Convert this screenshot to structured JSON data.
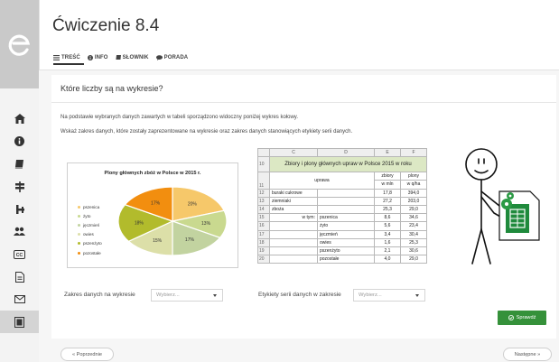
{
  "header": {
    "title": "Ćwiczenie 8.4",
    "tabs": [
      {
        "icon": "list-icon",
        "label": "TREŚĆ"
      },
      {
        "icon": "info-icon",
        "label": "INFO"
      },
      {
        "icon": "book-icon",
        "label": "SŁOWNIK"
      },
      {
        "icon": "chat-icon",
        "label": "PORADA"
      }
    ]
  },
  "sidebar": {
    "items": [
      "home-icon",
      "info-icon",
      "book-icon",
      "signpost-icon",
      "tool-icon",
      "people-icon",
      "cc-icon",
      "document-icon",
      "mail-icon",
      "notepad-icon"
    ]
  },
  "exercise": {
    "question": "Które liczby są na wykresie?",
    "p1": "Na podstawie wybranych danych zawartych w tabeli sporządzono widoczny poniżej wykres kołowy.",
    "p2": "Wskaż zakres danych, które zostały zaprezentowane na wykresie oraz zakres danych stanowiących etykiety serii danych."
  },
  "chart_data": {
    "type": "pie",
    "title": "Plony głównych zbóż w Polsce w 2015 r.",
    "categories": [
      "pszenica",
      "żyto",
      "jęczmień",
      "owies",
      "pszenżyto",
      "pozostałe"
    ],
    "values": [
      20,
      13,
      17,
      15,
      18,
      17
    ],
    "labels": [
      "20%",
      "13%",
      "17%",
      "15%",
      "18%",
      "17%"
    ],
    "colors": [
      "#f6c86a",
      "#c9d98f",
      "#c2d3a0",
      "#dcdfa8",
      "#b2bb2c",
      "#f28e0f"
    ],
    "legend": "left"
  },
  "sheet": {
    "cols": [
      "C",
      "D",
      "E",
      "F"
    ],
    "title": "Zbiory i plony głównych upraw w Polsce 2015 w roku",
    "head": {
      "uprawa": "uprawa",
      "zbiory": "zbiory",
      "zbiory_unit": "w mln",
      "plony": "plony",
      "plony_unit": "w q/ha"
    },
    "rows": [
      {
        "n": "12",
        "c": "buraki cukrowe",
        "d": "",
        "e": "17,8",
        "f": "394,0"
      },
      {
        "n": "13",
        "c": "ziemniaki",
        "d": "",
        "e": "27,2",
        "f": "203,0"
      },
      {
        "n": "14",
        "c": "zboża",
        "d": "",
        "e": "25,3",
        "f": "29,0"
      },
      {
        "n": "15",
        "c": "w tym:",
        "d": "pszenica",
        "e": "8,6",
        "f": "34,6"
      },
      {
        "n": "16",
        "c": "",
        "d": "żyto",
        "e": "5,6",
        "f": "23,4"
      },
      {
        "n": "17",
        "c": "",
        "d": "jęczmień",
        "e": "3,4",
        "f": "30,4"
      },
      {
        "n": "18",
        "c": "",
        "d": "owies",
        "e": "1,6",
        "f": "25,3"
      },
      {
        "n": "19",
        "c": "",
        "d": "pszenżyto",
        "e": "2,1",
        "f": "30,6"
      },
      {
        "n": "20",
        "c": "",
        "d": "pozostałe",
        "e": "4,0",
        "f": "29,0"
      }
    ]
  },
  "form": {
    "label1": "Zakres danych na wykresie",
    "select1_placeholder": "Wybierz...",
    "label2": "Etykiety serii danych w zakresie",
    "select2_placeholder": "Wybierz...",
    "check_label": "Sprawdź"
  },
  "nav": {
    "prev": "« Poprzednie",
    "next": "Następne »"
  }
}
